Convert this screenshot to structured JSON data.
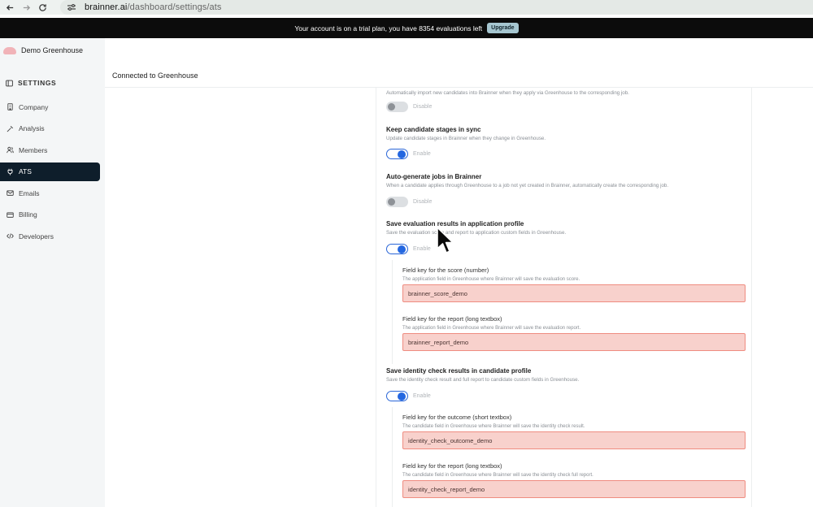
{
  "browser": {
    "url_host": "brainner.ai",
    "url_path": "/dashboard/settings/ats"
  },
  "banner": {
    "message": "Your account is on a trial plan, you have 8354 evaluations left",
    "upgrade_label": "Upgrade"
  },
  "sidebar": {
    "brand": "Demo Greenhouse",
    "section": "SETTINGS",
    "items": [
      {
        "label": "Company",
        "icon": "building-icon",
        "active": false
      },
      {
        "label": "Analysis",
        "icon": "sparkle-icon",
        "active": false
      },
      {
        "label": "Members",
        "icon": "users-icon",
        "active": false
      },
      {
        "label": "ATS",
        "icon": "plug-icon",
        "active": true
      },
      {
        "label": "Emails",
        "icon": "mail-icon",
        "active": false
      },
      {
        "label": "Billing",
        "icon": "credit-card-icon",
        "active": false
      },
      {
        "label": "Developers",
        "icon": "code-icon",
        "active": false
      }
    ]
  },
  "main": {
    "title": "Connected to Greenhouse",
    "settings": [
      {
        "title": "",
        "desc": "Automatically import new candidates into Brainner when they apply via Greenhouse to the corresponding job.",
        "toggle_label": "Disable",
        "enabled": false
      },
      {
        "title": "Keep candidate stages in sync",
        "desc": "Update candidate stages in Brainner when they change in Greenhouse.",
        "toggle_label": "Enable",
        "enabled": true
      },
      {
        "title": "Auto-generate jobs in Brainner",
        "desc": "When a candidate applies through Greenhouse to a job not yet created in Brainner, automatically create the corresponding job.",
        "toggle_label": "Disable",
        "enabled": false
      },
      {
        "title": "Save evaluation results in application profile",
        "desc": "Save the evaluation score and report to application custom fields in Greenhouse.",
        "toggle_label": "Enable",
        "enabled": true,
        "fields": [
          {
            "label": "Field key for the score (number)",
            "desc": "The application field in Greenhouse where Brainner will save the evaluation score.",
            "value": "brainner_score_demo"
          },
          {
            "label": "Field key for the report (long textbox)",
            "desc": "The application field in Greenhouse where Brainner will save the evaluation report.",
            "value": "brainner_report_demo"
          }
        ]
      },
      {
        "title": "Save identity check results in candidate profile",
        "desc": "Save the identity check result and full report to candidate custom fields in Greenhouse.",
        "toggle_label": "Enable",
        "enabled": true,
        "fields": [
          {
            "label": "Field key for the outcome (short textbox)",
            "desc": "The candidate field in Greenhouse where Brainner will save the identity check result.",
            "value": "identity_check_outcome_demo"
          },
          {
            "label": "Field key for the report (long textbox)",
            "desc": "The candidate field in Greenhouse where Brainner will save the identity check full report.",
            "value": "identity_check_report_demo"
          }
        ]
      }
    ]
  },
  "colors": {
    "accent_toggle": "#2467e0",
    "nav_active_bg": "#0e1e2b",
    "field_highlight_bg": "#f8d1cc",
    "field_highlight_border": "#ef8c80",
    "banner_bg": "#0c0c0c",
    "upgrade_bg": "#a6c6d0"
  }
}
